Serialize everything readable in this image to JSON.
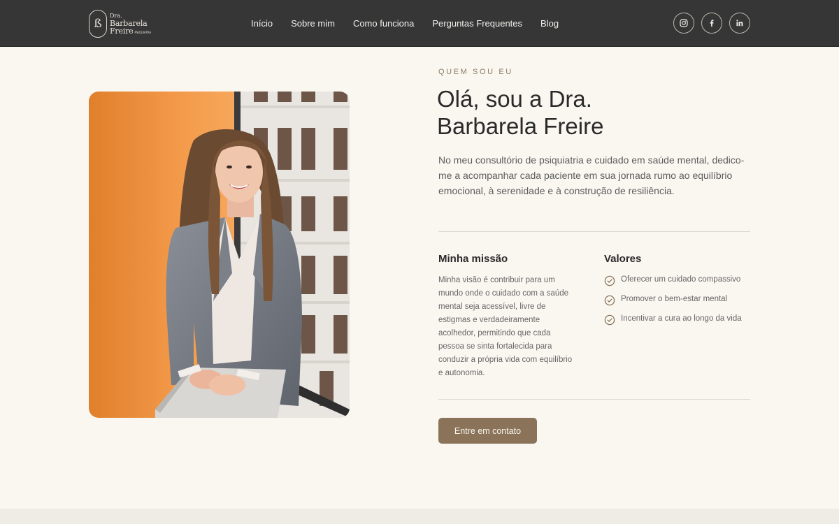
{
  "brand": {
    "monogram": "ß",
    "line1": "Dra.",
    "line2": "Barbarela",
    "line3": "Freire",
    "tagline": "PSIQUIATRA"
  },
  "nav": {
    "items": [
      "Início",
      "Sobre mim",
      "Como funciona",
      "Perguntas Frequentes",
      "Blog"
    ]
  },
  "socials": [
    "instagram-icon",
    "facebook-icon",
    "linkedin-icon"
  ],
  "about": {
    "eyebrow": "QUEM SOU EU",
    "title_line1": "Olá, sou a Dra.",
    "title_line2": "Barbarela Freire",
    "intro": "No meu consultório de psiquiatria e cuidado em saúde mental, dedico-me a acompanhar cada paciente em sua jornada rumo ao equilíbrio emocional, à serenidade e à construção de resiliência."
  },
  "mission": {
    "heading": "Minha missão",
    "text": "Minha visão é contribuir para um mundo onde o cuidado com a saúde mental seja acessível, livre de estigmas e verdadeiramente acolhedor, permitindo que cada pessoa se sinta fortalecida para conduzir a própria vida com equilíbrio e autonomia."
  },
  "values": {
    "heading": "Valores",
    "items": [
      "Oferecer um cuidado compassivo",
      "Promover o bem-estar mental",
      "Incentivar a cura ao longo da vida"
    ]
  },
  "cta": {
    "label": "Entre em contato"
  },
  "colors": {
    "header_bg": "#363636",
    "page_bg": "#faf7f1",
    "accent": "#8a7358",
    "photo_orange": "#f39a4a"
  }
}
